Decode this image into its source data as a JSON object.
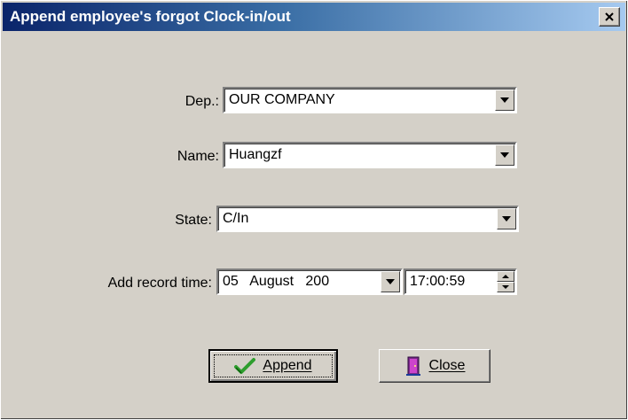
{
  "window": {
    "title": "Append employee's forgot Clock-in/out",
    "close_glyph": "✕"
  },
  "form": {
    "dep_label": "Dep.:",
    "dep_value": "OUR COMPANY",
    "name_label": "Name:",
    "name_value": "Huangzf",
    "state_label": "State:",
    "state_value": "C/In",
    "time_label": "Add record time:",
    "date_value": "05   August   200",
    "time_value": "17:00:59"
  },
  "buttons": {
    "append_label": "Append",
    "close_label": "Close"
  },
  "colors": {
    "title_start": "#0a246a",
    "title_end": "#a6caf0",
    "face": "#d4d0c8",
    "check_green": "#2e9e2e"
  }
}
